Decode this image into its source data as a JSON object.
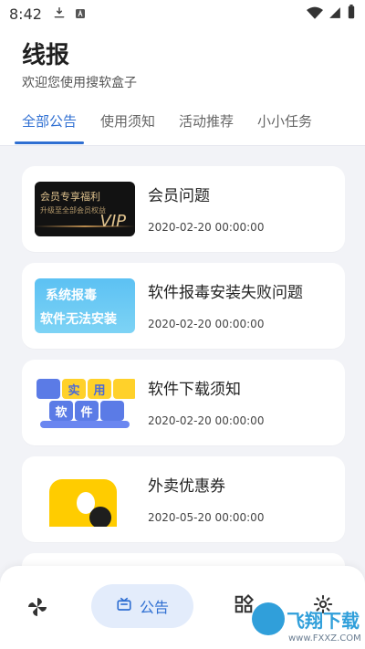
{
  "status": {
    "time": "8:42"
  },
  "header": {
    "title": "线报",
    "subtitle": "欢迎您使用搜软盒子"
  },
  "tabs": [
    {
      "label": "全部公告",
      "active": true
    },
    {
      "label": "使用须知",
      "active": false
    },
    {
      "label": "活动推荐",
      "active": false
    },
    {
      "label": "小小任务",
      "active": false
    }
  ],
  "posts": [
    {
      "title": "会员问题",
      "date": "2020-02-20 00:00:00",
      "thumb": {
        "type": "vip",
        "line1": "会员专享福利",
        "line2": "升级至全部会员权益",
        "badge": "VIP"
      }
    },
    {
      "title": "软件报毒安装失败问题",
      "date": "2020-02-20 00:00:00",
      "thumb": {
        "type": "virus",
        "line1": "系统报毒",
        "line2": "软件无法安装"
      }
    },
    {
      "title": "软件下载须知",
      "date": "2020-02-20 00:00:00",
      "thumb": {
        "type": "download",
        "tiles": [
          "实",
          "用",
          "软",
          "件"
        ]
      }
    },
    {
      "title": "外卖优惠券",
      "date": "2020-05-20 00:00:00",
      "thumb": {
        "type": "food"
      }
    }
  ],
  "bottom_nav": {
    "active_label": "公告",
    "items": [
      "pinwheel-icon",
      "notice-icon",
      "apps-icon",
      "settings-icon"
    ]
  },
  "watermark": {
    "text": "飞翔下载",
    "url": "www.FXXZ.COM"
  },
  "colors": {
    "accent": "#2f6fd2",
    "background": "#f2f3f7"
  }
}
